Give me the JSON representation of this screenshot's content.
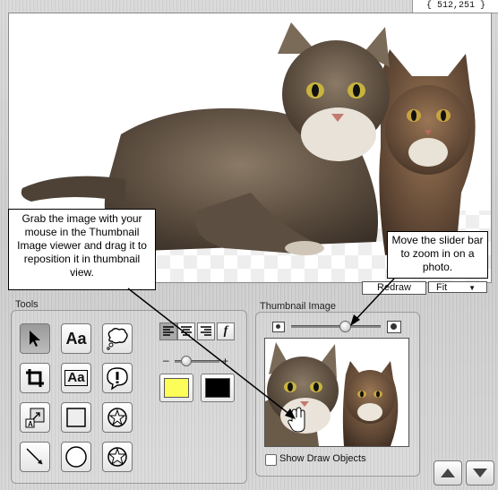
{
  "coords": "{ 512,251 }",
  "canvas": {
    "redraw_label": "Redraw",
    "fit_label": "Fit"
  },
  "callouts": {
    "thumbnail_help": "Grab the image with your mouse in the Thumbnail Image viewer and drag it to reposition it in thumbnail view.",
    "slider_help": "Move the slider bar to zoom in on a photo."
  },
  "tools_panel": {
    "title": "Tools",
    "buttons": [
      {
        "name": "arrow-tool",
        "label": ""
      },
      {
        "name": "text-tool",
        "label": "Aa"
      },
      {
        "name": "thought-bubble-tool",
        "label": ""
      },
      {
        "name": "crop-tool",
        "label": ""
      },
      {
        "name": "text-box-tool",
        "label": "Aa"
      },
      {
        "name": "exclamation-bubble-tool",
        "label": "!"
      },
      {
        "name": "resize-tool",
        "label": "A"
      },
      {
        "name": "rectangle-tool",
        "label": ""
      },
      {
        "name": "rotate-star-tool",
        "label": ""
      },
      {
        "name": "line-tool",
        "label": ""
      },
      {
        "name": "circle-tool",
        "label": ""
      },
      {
        "name": "star-tool",
        "label": ""
      }
    ],
    "font_style_label": "f",
    "size_minus": "–",
    "size_plus": "+",
    "fill_color": "#fdfd5a",
    "stroke_color": "#000000"
  },
  "thumbnail_panel": {
    "title": "Thumbnail Image",
    "zoom_level": 0.6,
    "show_draw_objects_label": "Show Draw Objects",
    "show_draw_objects_checked": false
  }
}
